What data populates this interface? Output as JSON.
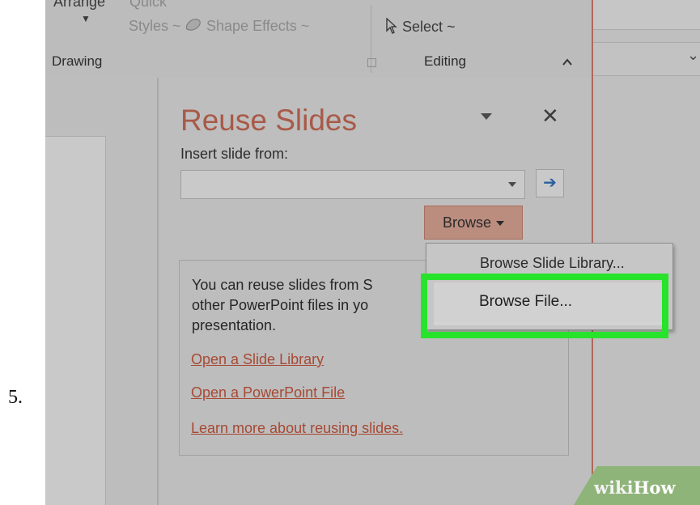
{
  "step_number": "5.",
  "ribbon": {
    "arrange_label": "Arrange",
    "quick_label": "Quick",
    "styles_label": "Styles",
    "styles_caret": "~",
    "shape_effects_label": "Shape Effects",
    "shape_effects_caret": "~",
    "select_label": "Select",
    "select_caret": "~",
    "drawing_group": "Drawing",
    "editing_group": "Editing"
  },
  "reuse_pane": {
    "title": "Reuse Slides",
    "insert_label": "Insert slide from:",
    "combo_value": "",
    "browse_label": "Browse",
    "info_text": "You can reuse slides from S\nother PowerPoint files in yo\npresentation.",
    "links": [
      "Open a Slide Library",
      "Open a PowerPoint File",
      "Learn more about reusing slides."
    ]
  },
  "browse_menu": {
    "items": [
      "Browse Slide Library...",
      "Browse File..."
    ],
    "highlighted_index": 1,
    "highlight_color": "#27e32b"
  },
  "watermark": {
    "text_wiki": "wiki",
    "text_how": "How"
  },
  "colors": {
    "accent": "#a85a48",
    "link": "#a74934",
    "go_arrow": "#2a5f9e"
  }
}
